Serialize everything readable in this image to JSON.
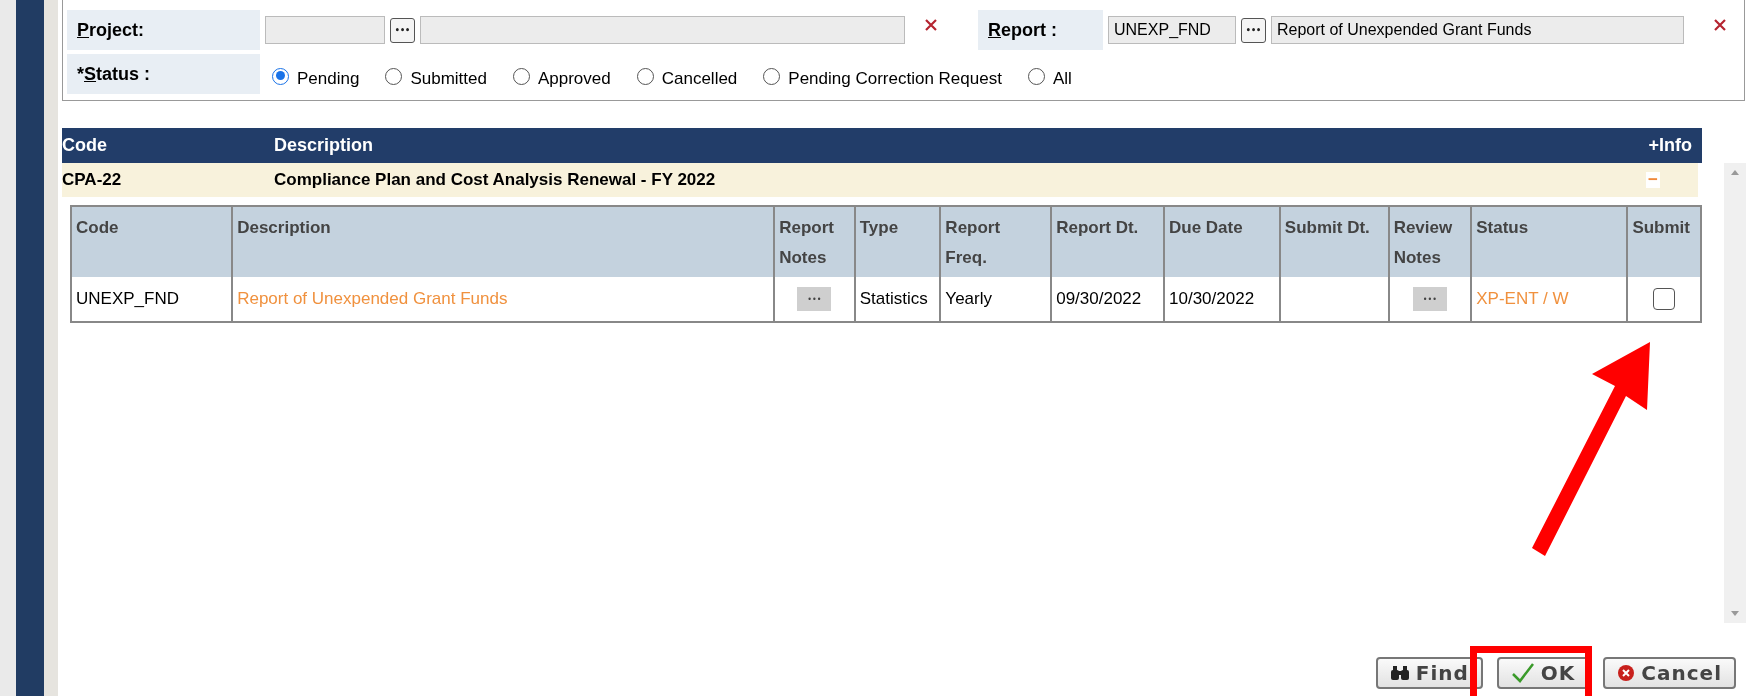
{
  "filter": {
    "project": {
      "label_key": "P",
      "label_rest": "roject:",
      "browse": "•••"
    },
    "report": {
      "label_key": "R",
      "label_rest": "eport :",
      "code": "UNEXP_FND",
      "browse": "•••",
      "name": "Report of Unexpended Grant Funds"
    },
    "status": {
      "required_mark": "*",
      "label_key": "S",
      "label_rest": "tatus :",
      "options": [
        {
          "label": "Pending",
          "selected": true
        },
        {
          "label": "Submitted",
          "selected": false
        },
        {
          "label": "Approved",
          "selected": false
        },
        {
          "label": "Cancelled",
          "selected": false
        },
        {
          "label": "Pending Correction Request",
          "selected": false
        },
        {
          "label": "All",
          "selected": false
        }
      ]
    }
  },
  "outer_table": {
    "columns": [
      "Code",
      "Description"
    ],
    "info": "+Info",
    "groups": [
      {
        "code": "CPA-22",
        "description": "Compliance Plan and Cost Analysis Renewal - FY 2022",
        "expanded": true,
        "toggle": "−",
        "table": {
          "columns": [
            "Code",
            "Description",
            "Report Notes",
            "Type",
            "Report Freq.",
            "Report Dt.",
            "Due Date",
            "Submit Dt.",
            "Review Notes",
            "Status",
            "Submit"
          ],
          "rows": [
            {
              "cells": [
                {
                  "kind": "text",
                  "text": "UNEXP_FND"
                },
                {
                  "kind": "link",
                  "text": "Report of Unexpended Grant Funds"
                },
                {
                  "kind": "notes",
                  "text": "•••"
                },
                {
                  "kind": "text",
                  "text": "Statistics"
                },
                {
                  "kind": "text",
                  "text": "Yearly"
                },
                {
                  "kind": "text",
                  "text": "09/30/2022"
                },
                {
                  "kind": "text",
                  "text": "10/30/2022"
                },
                {
                  "kind": "text",
                  "text": ""
                },
                {
                  "kind": "notes",
                  "text": "•••"
                },
                {
                  "kind": "link",
                  "text": "XP-ENT / W"
                },
                {
                  "kind": "checkbox",
                  "checked": false
                }
              ]
            }
          ]
        }
      }
    ]
  },
  "buttons": [
    {
      "kind": "find",
      "label": "Find"
    },
    {
      "kind": "ok",
      "label": "OK"
    },
    {
      "kind": "cancel",
      "label": "Cancel"
    }
  ],
  "annotations": [
    {
      "kind": "arrow"
    },
    {
      "kind": "box"
    }
  ]
}
